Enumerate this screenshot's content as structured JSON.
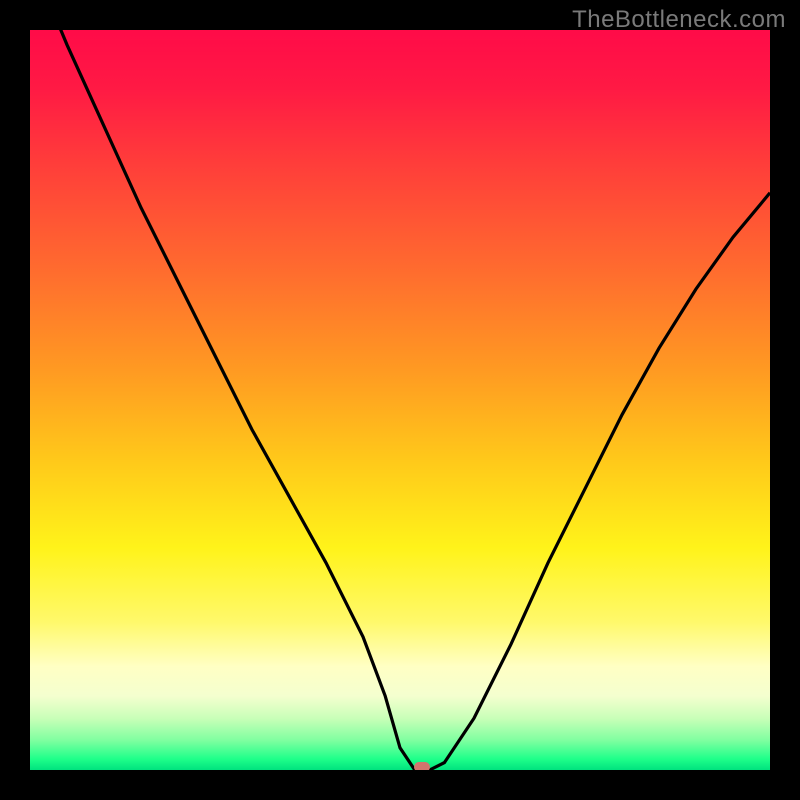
{
  "watermark": "TheBottleneck.com",
  "colors": {
    "frame": "#000000",
    "curve": "#000000",
    "marker": "#d2756d",
    "gradient_stops": [
      "#ff0b48",
      "#ff1a44",
      "#ff3d3a",
      "#ff6a2f",
      "#ff9a22",
      "#ffc81a",
      "#fff31a",
      "#fff96b",
      "#ffffc4",
      "#f4ffcf",
      "#c9ffb8",
      "#7fffa0",
      "#1fff8a",
      "#00e27f"
    ]
  },
  "chart_data": {
    "type": "line",
    "title": "",
    "xlabel": "",
    "ylabel": "",
    "xlim": [
      0,
      100
    ],
    "ylim": [
      0,
      100
    ],
    "annotations": [
      {
        "label": "optimal-point",
        "x": 53,
        "y": 0
      }
    ],
    "series": [
      {
        "name": "bottleneck-curve",
        "x": [
          0,
          5,
          10,
          15,
          20,
          25,
          30,
          35,
          40,
          45,
          48,
          50,
          52,
          54,
          56,
          60,
          65,
          70,
          75,
          80,
          85,
          90,
          95,
          100
        ],
        "y": [
          110,
          98,
          87,
          76,
          66,
          56,
          46,
          37,
          28,
          18,
          10,
          3,
          0,
          0,
          1,
          7,
          17,
          28,
          38,
          48,
          57,
          65,
          72,
          78
        ]
      }
    ]
  }
}
